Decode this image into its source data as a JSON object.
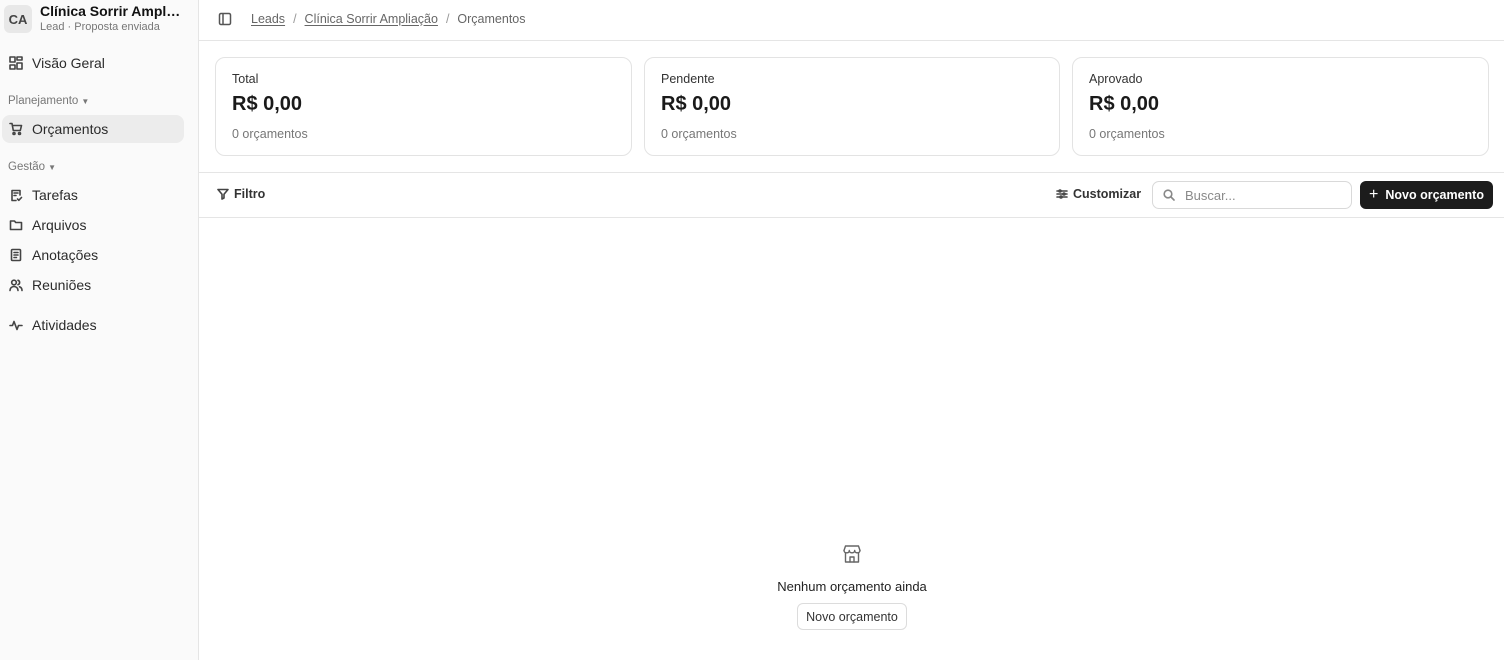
{
  "sidebar": {
    "avatar_initials": "CA",
    "lead_name": "Clínica Sorrir Ampliação",
    "lead_subtitle": "Lead · Proposta enviada",
    "overview": "Visão Geral",
    "section_planning": "Planejamento",
    "budgets": "Orçamentos",
    "section_management": "Gestão",
    "tasks": "Tarefas",
    "files": "Arquivos",
    "notes": "Anotações",
    "meetings": "Reuniões",
    "activities": "Atividades"
  },
  "breadcrumb": {
    "leads": "Leads",
    "lead": "Clínica Sorrir Ampliação",
    "current": "Orçamentos",
    "separator": "/"
  },
  "cards": [
    {
      "label": "Total",
      "value": "R$ 0,00",
      "count": "0 orçamentos"
    },
    {
      "label": "Pendente",
      "value": "R$ 0,00",
      "count": "0 orçamentos"
    },
    {
      "label": "Aprovado",
      "value": "R$ 0,00",
      "count": "0 orçamentos"
    }
  ],
  "toolbar": {
    "filter": "Filtro",
    "customize": "Customizar",
    "search_placeholder": "Buscar...",
    "new_budget": "Novo orçamento"
  },
  "empty_state": {
    "title": "Nenhum orçamento ainda",
    "button": "Novo orçamento"
  },
  "colors": {
    "primary_button": "#1c1c1c",
    "active_nav": "#ececec",
    "sidebar_bg": "#fafafa"
  }
}
